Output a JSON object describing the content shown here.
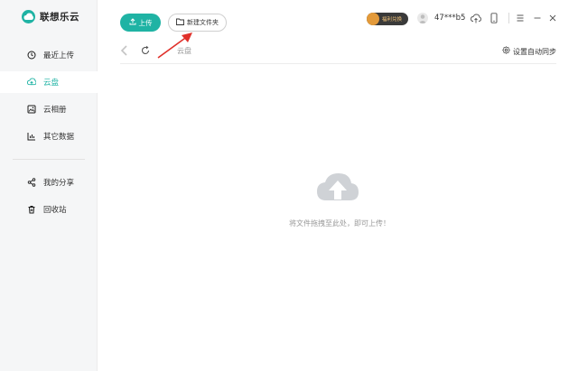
{
  "app": {
    "name": "联想乐云",
    "brand_color": "#1fb3a4"
  },
  "sidebar": {
    "items": [
      {
        "label": "最近上传",
        "icon": "clock-icon",
        "active": false
      },
      {
        "label": "云盘",
        "icon": "cloud-upload-icon",
        "active": true
      },
      {
        "label": "云相册",
        "icon": "image-icon",
        "active": false
      },
      {
        "label": "其它数据",
        "icon": "bar-chart-icon",
        "active": false
      },
      {
        "label": "我的分享",
        "icon": "share-icon",
        "active": false
      },
      {
        "label": "回收站",
        "icon": "trash-icon",
        "active": false
      }
    ]
  },
  "toolbar": {
    "upload_label": "上传",
    "new_folder_label": "新建文件夹"
  },
  "header": {
    "vip_label": "福利兑换",
    "username": "47***b5",
    "icons": [
      "cloud-transfer-icon",
      "phone-icon",
      "menu-icon",
      "minimize-icon",
      "close-icon"
    ]
  },
  "nav": {
    "breadcrumb": "云盘",
    "auto_sync_label": "设置自动同步"
  },
  "main": {
    "empty_hint": "将文件拖拽至此处，即可上传！"
  }
}
